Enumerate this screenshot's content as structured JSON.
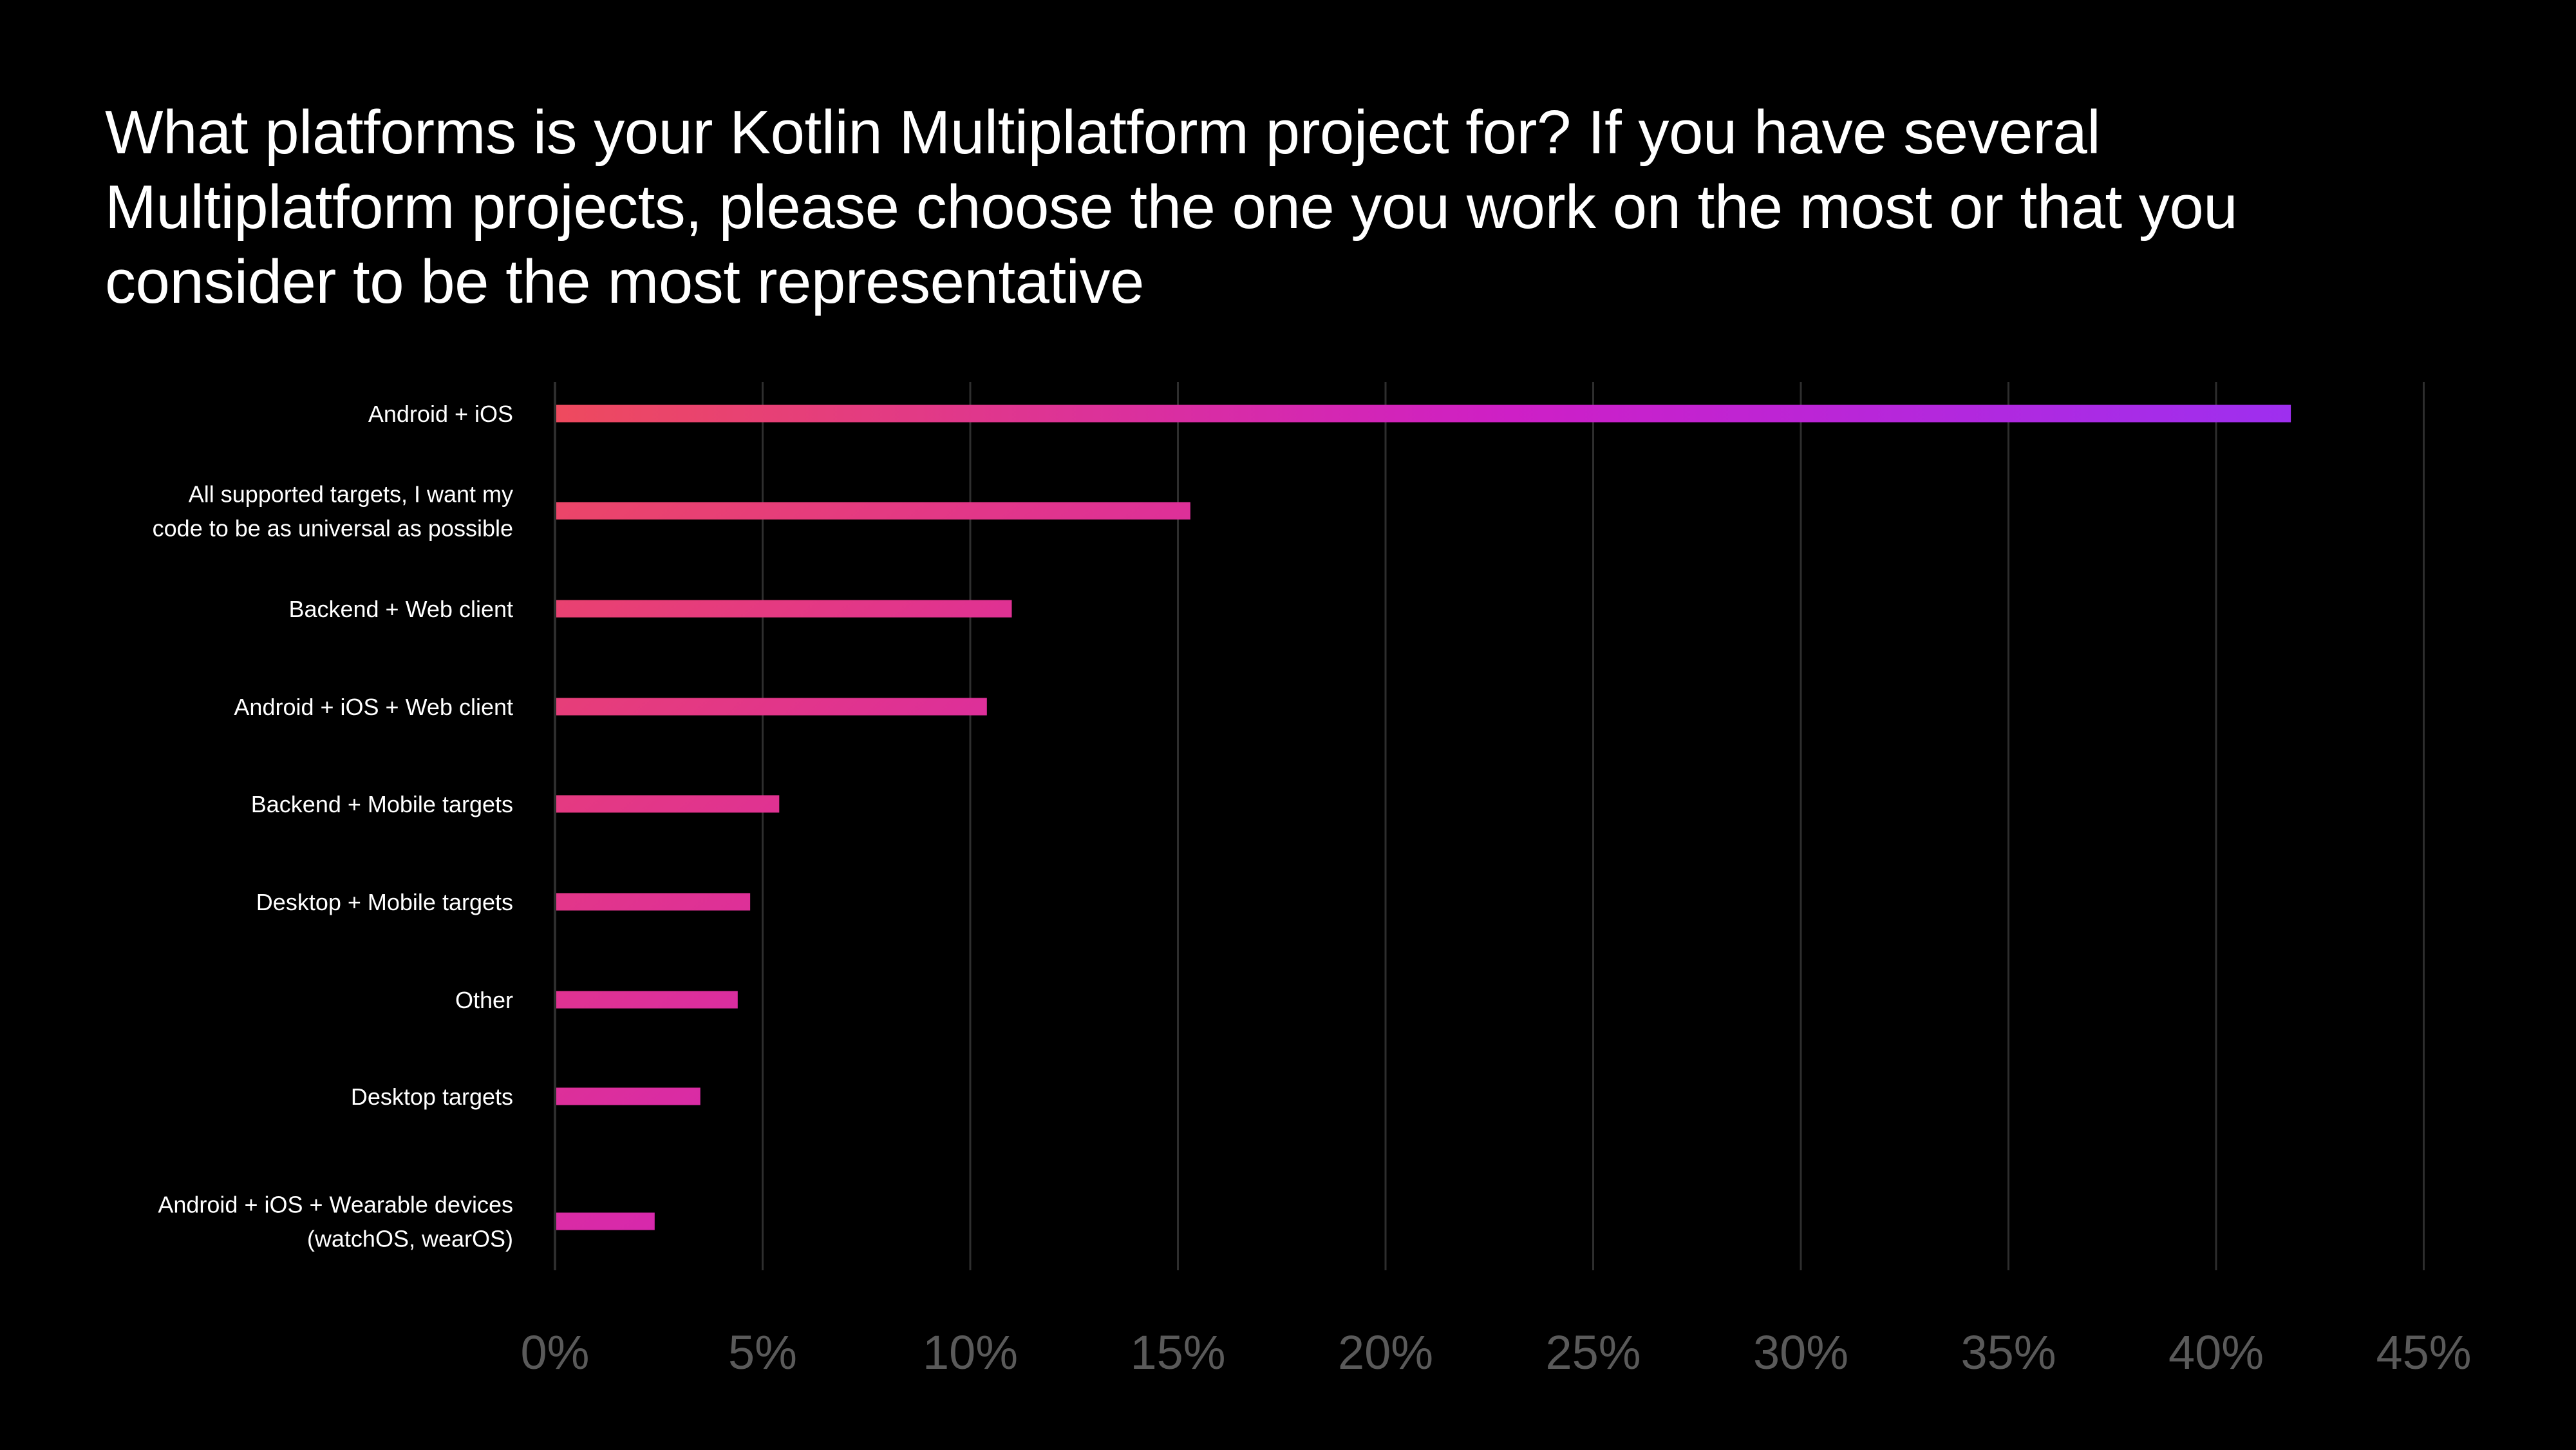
{
  "title": "What platforms is your Kotlin Multiplatform project for? If you have several Multiplatform projects, please choose the one you work on the most or that you consider to be the most representative",
  "chart_data": {
    "type": "bar",
    "orientation": "horizontal",
    "title": "What platforms is your Kotlin Multiplatform project for? If you have several Multiplatform projects, please choose the one you work on the most or that you consider to be the most representative",
    "xlabel": "",
    "ylabel": "",
    "categories": [
      [
        "Android + iOS"
      ],
      [
        "All supported targets, I want my",
        "code to be as universal as possible"
      ],
      [
        "Backend + Web client"
      ],
      [
        "Android + iOS + Web client"
      ],
      [
        "Backend + Mobile targets"
      ],
      [
        "Desktop + Mobile targets"
      ],
      [
        "Other"
      ],
      [
        "Desktop targets"
      ],
      [
        "Android + iOS + Wearable devices",
        "(watchOS, wearOS)"
      ]
    ],
    "values": [
      41.8,
      15.3,
      11.0,
      10.4,
      5.4,
      4.7,
      4.4,
      3.5,
      2.4
    ],
    "unit": "%",
    "xlim": [
      0,
      45
    ],
    "xticks": [
      0,
      5,
      10,
      15,
      20,
      25,
      30,
      35,
      40,
      45
    ],
    "xtick_labels": [
      "0%",
      "5%",
      "10%",
      "15%",
      "20%",
      "25%",
      "30%",
      "35%",
      "40%",
      "45%"
    ],
    "grid": true,
    "legend": "none",
    "colors": {
      "background": "#000000",
      "gradient": [
        "#EE4A5E",
        "#E03390",
        "#CE1FC6",
        "#A030EE"
      ],
      "grid": "#2E2E2E",
      "axis": "#2E2E2E",
      "tick_label": "#5A5A5A",
      "category_label": "#FFFFFF"
    }
  }
}
